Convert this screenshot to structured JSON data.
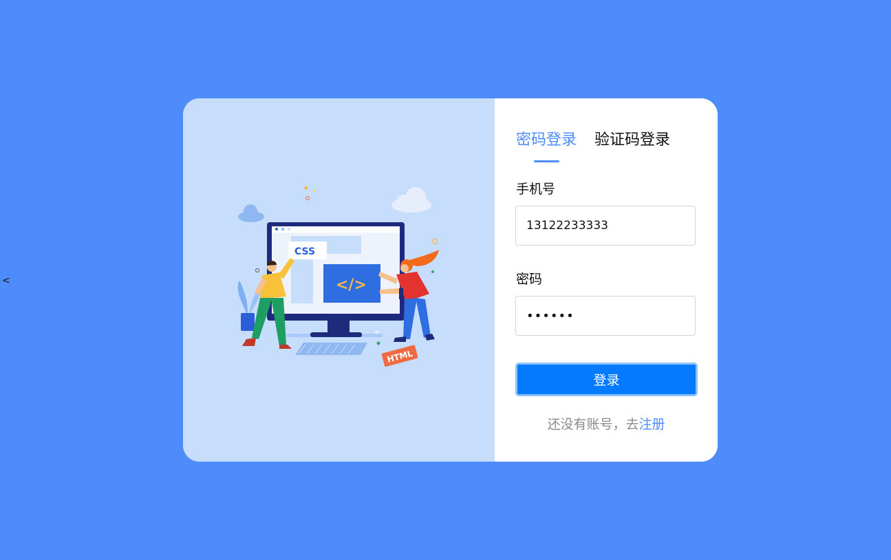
{
  "stray_text": "<",
  "tabs": [
    {
      "label": "密码登录",
      "active": true
    },
    {
      "label": "验证码登录",
      "active": false
    }
  ],
  "phone": {
    "label": "手机号",
    "value": "13122233333"
  },
  "password": {
    "label": "密码",
    "value": "••••••"
  },
  "login_button": "登录",
  "register": {
    "prompt": "还没有账号，去",
    "link": "注册"
  },
  "illustration": {
    "css_tag": "CSS",
    "code_tag": "</>",
    "html_tag": "HTML"
  },
  "colors": {
    "page_background": "#4e8cfb",
    "illustration_panel": "#c7ddfc",
    "accent": "#4e8cfb",
    "button": "#047bff"
  }
}
